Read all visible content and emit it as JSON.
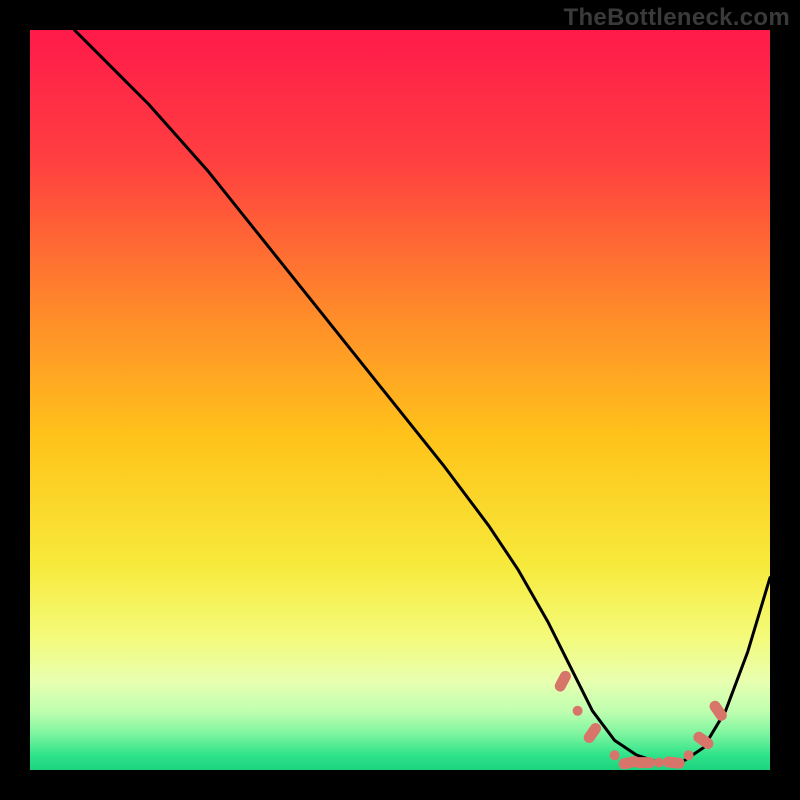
{
  "watermark": "TheBottleneck.com",
  "colors": {
    "background_black": "#000000",
    "curve": "#000000",
    "dot_fill": "#d8756b",
    "dot_stroke": "#b25a50",
    "gradient_stops": [
      {
        "offset": "0%",
        "color": "#ff1a4a"
      },
      {
        "offset": "18%",
        "color": "#ff4040"
      },
      {
        "offset": "38%",
        "color": "#ff8a2a"
      },
      {
        "offset": "55%",
        "color": "#ffc31a"
      },
      {
        "offset": "72%",
        "color": "#f7e93a"
      },
      {
        "offset": "82%",
        "color": "#f4fb7a"
      },
      {
        "offset": "88%",
        "color": "#e8ffb0"
      },
      {
        "offset": "92%",
        "color": "#c0ffb0"
      },
      {
        "offset": "95%",
        "color": "#80f5a0"
      },
      {
        "offset": "98%",
        "color": "#2fe389"
      },
      {
        "offset": "100%",
        "color": "#1cd37f"
      }
    ]
  },
  "chart_data": {
    "type": "line",
    "title": "",
    "xlabel": "",
    "ylabel": "",
    "x_range": [
      0,
      100
    ],
    "y_range": [
      0,
      100
    ],
    "series": [
      {
        "name": "bottleneck-curve",
        "x": [
          6,
          10,
          16,
          24,
          32,
          40,
          48,
          56,
          62,
          66,
          70,
          73,
          76,
          79,
          82,
          85,
          88,
          91,
          94,
          97,
          100
        ],
        "y": [
          100,
          96,
          90,
          81,
          71,
          61,
          51,
          41,
          33,
          27,
          20,
          14,
          8,
          4,
          2,
          1,
          1,
          3,
          8,
          16,
          26
        ]
      }
    ],
    "flat_region_x": [
      78,
      90
    ],
    "markers": [
      {
        "x": 72,
        "y": 12,
        "kind": "pill",
        "angle": -62
      },
      {
        "x": 74,
        "y": 8,
        "kind": "dot"
      },
      {
        "x": 76,
        "y": 5,
        "kind": "pill",
        "angle": -55
      },
      {
        "x": 79,
        "y": 2,
        "kind": "dot"
      },
      {
        "x": 81,
        "y": 1,
        "kind": "pill",
        "angle": -12
      },
      {
        "x": 83,
        "y": 1,
        "kind": "pill",
        "angle": 0
      },
      {
        "x": 85,
        "y": 1,
        "kind": "dot"
      },
      {
        "x": 87,
        "y": 1,
        "kind": "pill",
        "angle": 6
      },
      {
        "x": 89,
        "y": 2,
        "kind": "dot"
      },
      {
        "x": 91,
        "y": 4,
        "kind": "pill",
        "angle": 35
      },
      {
        "x": 93,
        "y": 8,
        "kind": "pill",
        "angle": 55
      }
    ]
  }
}
